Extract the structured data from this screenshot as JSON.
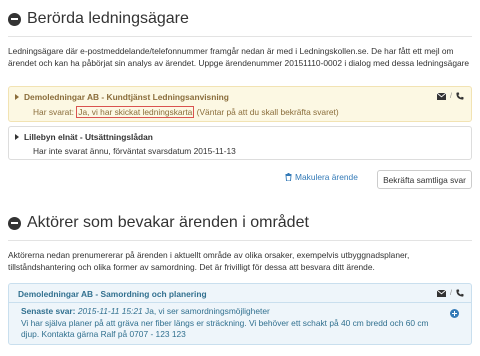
{
  "section1": {
    "title": "Berörda ledningsägare",
    "intro": "Ledningsägare där e-postmeddelande/telefonnummer framgår nedan är med i Ledningskollen.se. De har fått ett mejl om ärendet och kan ha påbörjat sin analys av ärendet. Uppge ärendenummer 20151110-0002 i dialog med dessa ledningsägare",
    "owners": [
      {
        "name": "Demoledningar AB - Kundtjänst Ledningsanvisning",
        "status_prefix": "Har svarat: ",
        "status_highlight": "Ja, vi har skickat ledningskarta",
        "status_suffix": " (Väntar på att du skall bekräfta svaret)"
      },
      {
        "name": "Lillebyn elnät - Utsättningslådan",
        "status": "Har inte svarat ännu, förväntat svarsdatum 2015-11-13"
      }
    ],
    "makulera_label": "Makulera ärende",
    "confirm_all_label": "Bekräfta samtliga svar"
  },
  "section2": {
    "title": "Aktörer som bevakar ärenden i området",
    "intro": "Aktörerna nedan prenumererar på ärenden i aktuellt område av olika orsaker, exempelvis utbyggnadsplaner, tillståndshantering och olika former av samordning. Det är frivilligt för dessa att besvara ditt ärende.",
    "actor": {
      "name": "Demoledningar AB - Samordning och planering",
      "reply_label": "Senaste svar: ",
      "reply_timestamp": "2015-11-11 15:21",
      "reply_short": " Ja, vi ser samordningsmöjligheter",
      "reply_text": "Vi har själva planer på att gräva ner fiber längs er sträckning. Vi behöver ett schakt på 40 cm bredd och 60 cm djup. Kontakta gärna Ralf på 0707 - 123 123"
    }
  },
  "icons": {
    "section_toggle": "minus-circle-icon",
    "email": "envelope-icon",
    "phone": "phone-icon",
    "trash": "trash-icon",
    "expand": "plus-circle-icon",
    "caret": "caret-right-icon"
  },
  "colors": {
    "warning_bg": "#fcf8e3",
    "warning_text": "#8a6d3b",
    "info_bg": "#eef5fa",
    "info_text": "#31708f",
    "link": "#337ab7",
    "highlight_border": "#d9534f"
  }
}
